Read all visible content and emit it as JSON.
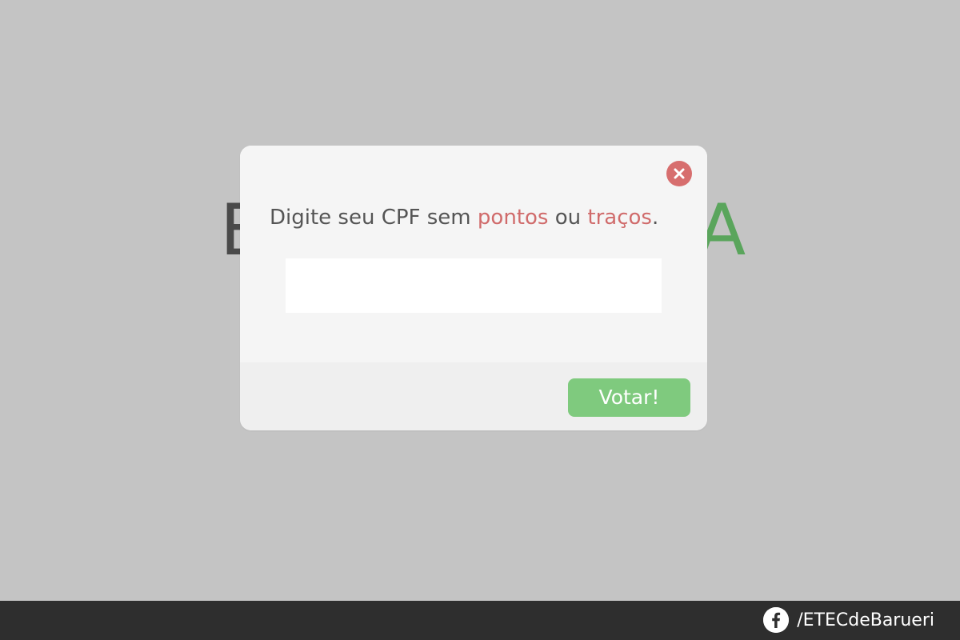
{
  "background": {
    "title_fragment_left": "E",
    "title_fragment_right": "A"
  },
  "modal": {
    "close_icon": "close-icon",
    "prompt": {
      "part1": "Digite seu CPF sem ",
      "highlight1": "pontos",
      "part2": " ou ",
      "highlight2": "traços",
      "part3": "."
    },
    "cpf_input": {
      "value": "",
      "placeholder": ""
    },
    "vote_button_label": "Votar!"
  },
  "footer": {
    "facebook_icon": "facebook-icon",
    "facebook_link_text": "/ETECdeBarueri"
  },
  "colors": {
    "overlay_background": "#c4c4c4",
    "modal_background": "#f5f5f5",
    "footer_strip": "#efefef",
    "close_button": "#d76e6e",
    "highlight_text": "#d06b6b",
    "vote_button": "#7fca7e",
    "page_footer": "#2e2e2e"
  }
}
